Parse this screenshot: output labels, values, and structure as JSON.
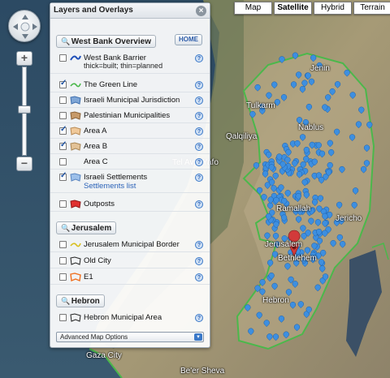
{
  "map_type": {
    "buttons": [
      {
        "label": "Map",
        "active": false
      },
      {
        "label": "Satellite",
        "active": true
      },
      {
        "label": "Hybrid",
        "active": false
      },
      {
        "label": "Terrain",
        "active": false
      }
    ]
  },
  "zoom": {
    "plus": "+",
    "minus": "−"
  },
  "panel": {
    "title": "Layers and Overlays",
    "close": "×",
    "home_label": "HOME",
    "west_bank": {
      "title": "West Bank Overview",
      "items": [
        {
          "label": "West Bank Barrier",
          "sub": "thick=built; thin=planned",
          "checked": false
        },
        {
          "label": "The Green Line",
          "checked": true
        },
        {
          "label": "Israeli Municipal Jurisdiction",
          "checked": false
        },
        {
          "label": "Palestinian Municipalities",
          "checked": false
        },
        {
          "label": "Area A",
          "checked": true
        },
        {
          "label": "Area B",
          "checked": true
        },
        {
          "label": "Area C",
          "checked": false
        },
        {
          "label": "Israeli Settlements",
          "link": "Settlements list",
          "checked": true
        },
        {
          "label": "Outposts",
          "checked": false
        }
      ]
    },
    "jerusalem": {
      "title": "Jerusalem",
      "items": [
        {
          "label": "Jerusalem Municipal Border",
          "checked": false
        },
        {
          "label": "Old City",
          "checked": false
        },
        {
          "label": "E1",
          "checked": false
        }
      ]
    },
    "hebron": {
      "title": "Hebron",
      "items": [
        {
          "label": "Hebron Municipal Area",
          "checked": false
        }
      ]
    },
    "advanced": "Advanced Map Options",
    "help": "?"
  },
  "places": [
    "Jenin",
    "Tulkarm",
    "Nablus",
    "Qalqiliya",
    "Tel Aviv-Yafo",
    "Ramallah",
    "Jericho",
    "Jerusalem",
    "Bethlehem",
    "Hebron",
    "Gaza City",
    "Be'er Sheva"
  ],
  "colors": {
    "green_line": "#4bb84b",
    "settlement_marker": "#3d8fe0",
    "barrier": "#1f4fb8",
    "jurisdiction": "#7fa6d6",
    "palestinian_muni": "#c79a6a",
    "area_a": "#f0c99a",
    "area_b": "#e3c296",
    "settlements_swatch": "#9cc0ea",
    "outposts": "#e03030",
    "jerusalem_border": "#d8c020",
    "e1": "#f07020"
  }
}
